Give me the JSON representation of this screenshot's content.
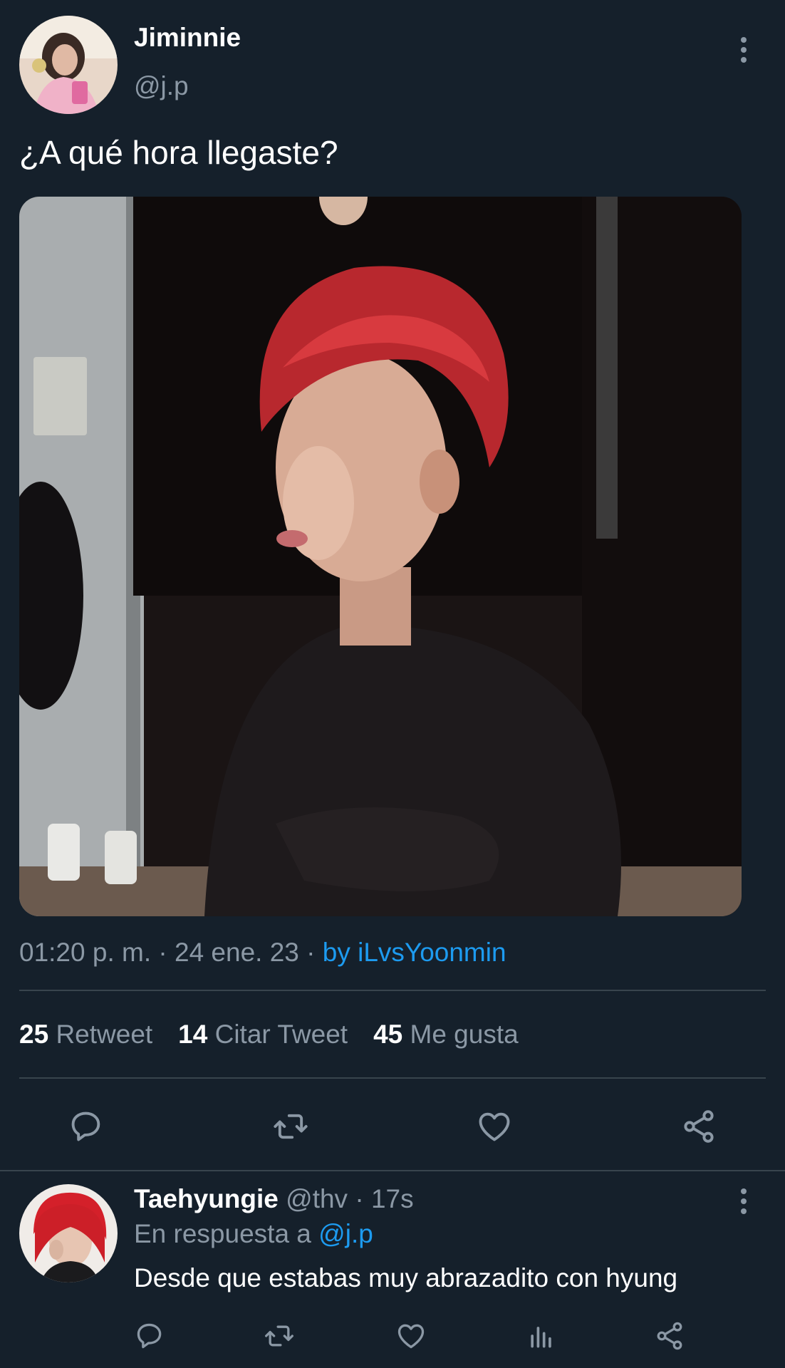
{
  "tweet": {
    "author_name": "Jiminnie",
    "author_handle": "@j.p",
    "text": "¿A qué hora llegaste?",
    "timestamp": "01:20 p. m. · 24 ene. 23 · ",
    "source": "by iLvsYoonmin",
    "stats": [
      {
        "count": "25",
        "label": "Retweet"
      },
      {
        "count": "14",
        "label": "Citar Tweet"
      },
      {
        "count": "45",
        "label": "Me gusta"
      }
    ],
    "actions": [
      "reply-icon",
      "retweet-icon",
      "like-icon",
      "share-icon"
    ]
  },
  "reply": {
    "author_name": "Taehyungie",
    "author_handle": "@thv · 17s",
    "in_reply_prefix": "En respuesta a ",
    "in_reply_handle": "@j.p",
    "text": "Desde que estabas muy abrazadito con hyung",
    "actions": [
      "reply-icon",
      "retweet-icon",
      "like-icon",
      "analytics-icon",
      "share-icon"
    ]
  },
  "colors": {
    "background": "#15202b",
    "muted": "#8b98a5",
    "link": "#1d9bf0",
    "divider": "#38444d"
  }
}
